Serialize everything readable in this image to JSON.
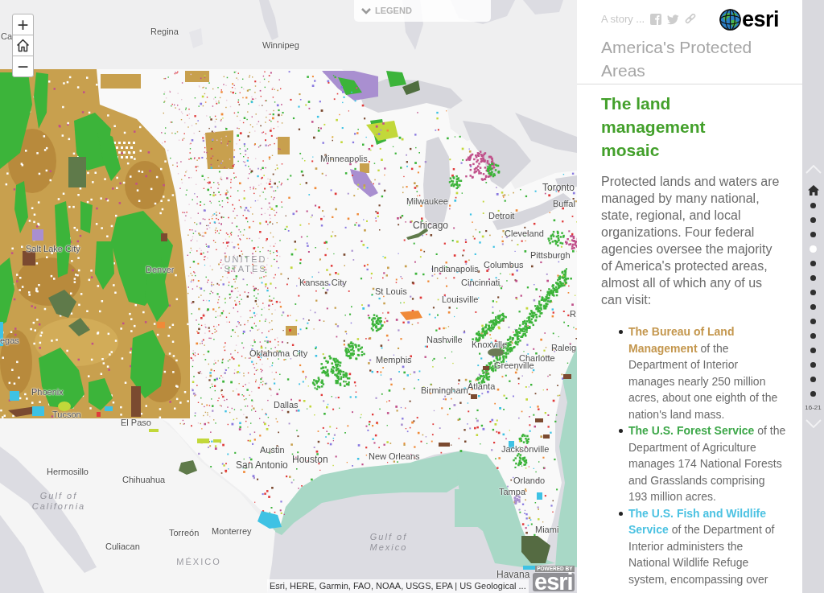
{
  "map": {
    "legend": {
      "label": "LEGEND",
      "expanded": false
    },
    "zoom_in": "+",
    "zoom_out": "−",
    "labels": [
      {
        "text": "Ca",
        "kind": "city"
      },
      {
        "text": "Regina",
        "kind": "city"
      },
      {
        "text": "Winnipeg",
        "kind": "city"
      },
      {
        "text": "Minneapolis",
        "kind": "city"
      },
      {
        "text": "Toronto",
        "kind": "city"
      },
      {
        "text": "Milwaukee",
        "kind": "city"
      },
      {
        "text": "Buffal",
        "kind": "city"
      },
      {
        "text": "Detroit",
        "kind": "city"
      },
      {
        "text": "Chicago",
        "kind": "city"
      },
      {
        "text": "Cleveland",
        "kind": "city"
      },
      {
        "text": "Salt Lake City",
        "kind": "city"
      },
      {
        "text": "Pittsburgh",
        "kind": "city"
      },
      {
        "text": "Denver",
        "kind": "city"
      },
      {
        "text": "UNITED STATES",
        "kind": "country"
      },
      {
        "text": "Indianapolis",
        "kind": "city"
      },
      {
        "text": "Columbus",
        "kind": "city"
      },
      {
        "text": "Kansas City",
        "kind": "city"
      },
      {
        "text": "Cincinnati",
        "kind": "city"
      },
      {
        "text": "St Louis",
        "kind": "city"
      },
      {
        "text": "Louisville",
        "kind": "city"
      },
      {
        "text": "R",
        "kind": "city"
      },
      {
        "text": "egas",
        "kind": "city"
      },
      {
        "text": "Nashville",
        "kind": "city"
      },
      {
        "text": "Knoxville",
        "kind": "city"
      },
      {
        "text": "Raleig",
        "kind": "city"
      },
      {
        "text": "Oklahoma City",
        "kind": "city"
      },
      {
        "text": "Memphis",
        "kind": "city"
      },
      {
        "text": "Charlotte",
        "kind": "city"
      },
      {
        "text": "Greenville",
        "kind": "city"
      },
      {
        "text": "Phoenix",
        "kind": "city"
      },
      {
        "text": "Birmingham",
        "kind": "city"
      },
      {
        "text": "Atlanta",
        "kind": "city"
      },
      {
        "text": "Dallas",
        "kind": "city"
      },
      {
        "text": "Tucson",
        "kind": "city"
      },
      {
        "text": "El Paso",
        "kind": "city"
      },
      {
        "text": "Austin",
        "kind": "city"
      },
      {
        "text": "Jacksonville",
        "kind": "city"
      },
      {
        "text": "San Antonio",
        "kind": "city"
      },
      {
        "text": "Houston",
        "kind": "city"
      },
      {
        "text": "New Orleans",
        "kind": "city"
      },
      {
        "text": "Hermosillo",
        "kind": "city"
      },
      {
        "text": "Chihuahua",
        "kind": "city"
      },
      {
        "text": "Orlando",
        "kind": "city"
      },
      {
        "text": "Tampa",
        "kind": "city"
      },
      {
        "text": "Gulf of California",
        "kind": "water"
      },
      {
        "text": "Torreón",
        "kind": "city"
      },
      {
        "text": "Monterrey",
        "kind": "city"
      },
      {
        "text": "Miami",
        "kind": "city"
      },
      {
        "text": "Culiacan",
        "kind": "city"
      },
      {
        "text": "Gulf of Mexico",
        "kind": "water"
      },
      {
        "text": "MÉXICO",
        "kind": "country"
      },
      {
        "text": "Havana",
        "kind": "city"
      }
    ],
    "attribution": "Esri, HERE, Garmin, FAO, NOAA, USGS, EPA | US Geological ...",
    "logo": {
      "caption": "POWERED BY",
      "wordmark": "esri"
    }
  },
  "story_panel": {
    "tagline": "A story ...",
    "brand": "esri",
    "title": "America's Protected Areas",
    "heading": "The land management mosaic",
    "intro": "Protected lands and waters are managed by many national, state, regional, and local organizations. Four federal agencies oversee the majority of America's protected areas, almost all of which any of us can visit:",
    "agencies": [
      {
        "name": "The Bureau of Land Management",
        "color": "#c4974e",
        "text": "of the Department of Interior manages nearly 250 million acres, about one eighth of the nation's land mass."
      },
      {
        "name": "The U.S. Forest Service",
        "color": "#3ea84a",
        "text": "of the Department of Agriculture manages 174 National Forests and Grasslands comprising 193 million acres."
      },
      {
        "name": "The U.S. Fish and Wildlife Service",
        "color": "#4cc2e2",
        "text": "of the Department of Interior administers the National Wildlife Refuge system, encompassing over"
      }
    ]
  },
  "navigation": {
    "items": [
      {
        "kind": "home",
        "selected": false
      },
      {
        "kind": "dot",
        "selected": false
      },
      {
        "kind": "dot",
        "selected": false
      },
      {
        "kind": "dot",
        "selected": false
      },
      {
        "kind": "dot",
        "selected": true
      },
      {
        "kind": "dot",
        "selected": false
      },
      {
        "kind": "dot",
        "selected": false
      },
      {
        "kind": "dot",
        "selected": false
      },
      {
        "kind": "dot",
        "selected": false
      },
      {
        "kind": "dot",
        "selected": false
      },
      {
        "kind": "dot",
        "selected": false
      },
      {
        "kind": "dot",
        "selected": false
      },
      {
        "kind": "dot",
        "selected": false
      },
      {
        "kind": "dot",
        "selected": false
      },
      {
        "kind": "dot",
        "selected": false
      }
    ],
    "range": "16-21"
  }
}
